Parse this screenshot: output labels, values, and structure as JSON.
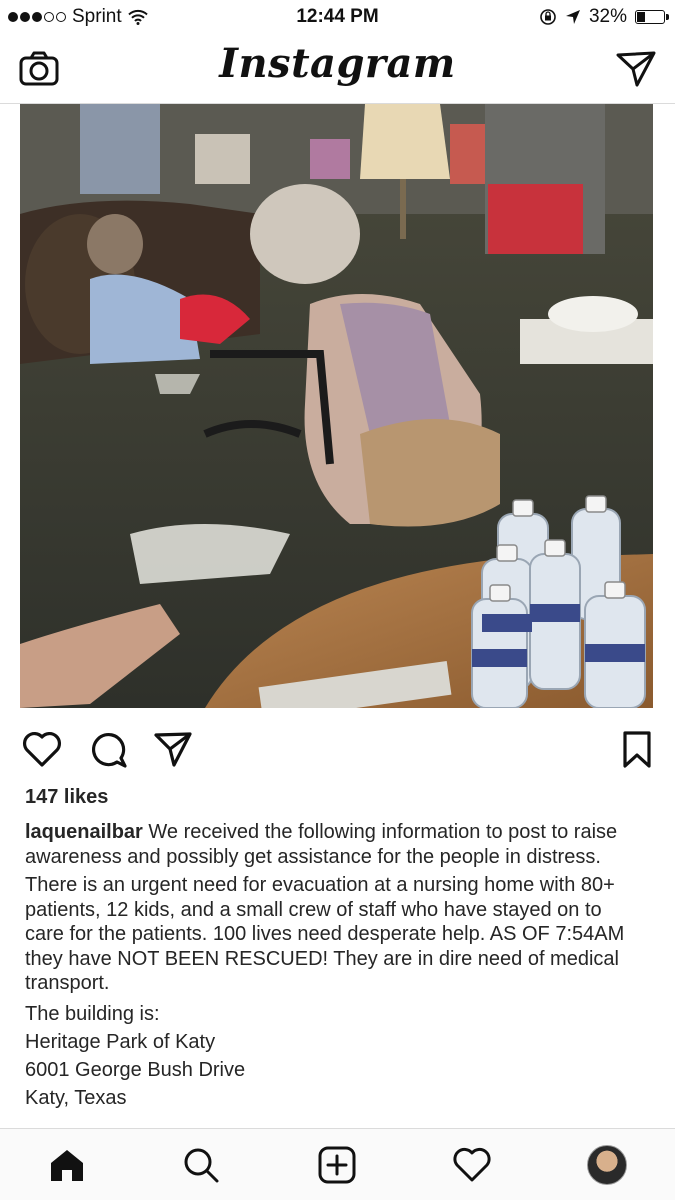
{
  "status_bar": {
    "carrier": "Sprint",
    "time": "12:44 PM",
    "battery": "32%",
    "battery_level": 0.32,
    "icons": [
      "signal-dots-icon",
      "wifi-icon",
      "orientation-lock-icon",
      "location-arrow-icon",
      "battery-icon"
    ]
  },
  "nav": {
    "brand": "Instagram",
    "left_icon": "camera-icon",
    "right_icon": "direct-message-icon"
  },
  "post": {
    "photo": "nursing-home-flood-photo",
    "actions": [
      "like-icon",
      "comment-icon",
      "share-icon",
      "bookmark-icon"
    ],
    "likes": "147 likes",
    "username": "laquenailbar",
    "caption_first": " We received the following information to post to raise awareness and possibly get assistance for the people in distress.",
    "caption_second": "There is an urgent need for evacuation at a nursing home with 80+ patients, 12 kids, and a small crew of staff who have stayed on to care for the patients. 100 lives need desperate help. AS OF 7:54AM they have NOT BEEN RESCUED! They are in dire need of medical transport.",
    "building_label": "The building is:",
    "address_line1": "Heritage Park of Katy",
    "address_line2": "6001 George Bush Drive",
    "address_line3": "Katy, Texas"
  },
  "tab_bar": {
    "items": [
      "home-icon",
      "search-icon",
      "new-post-icon",
      "activity-icon",
      "profile-avatar"
    ]
  },
  "colors": {
    "text": "#262626",
    "divider": "#dbdbdb",
    "tabbar_bg": "#fafafa"
  }
}
